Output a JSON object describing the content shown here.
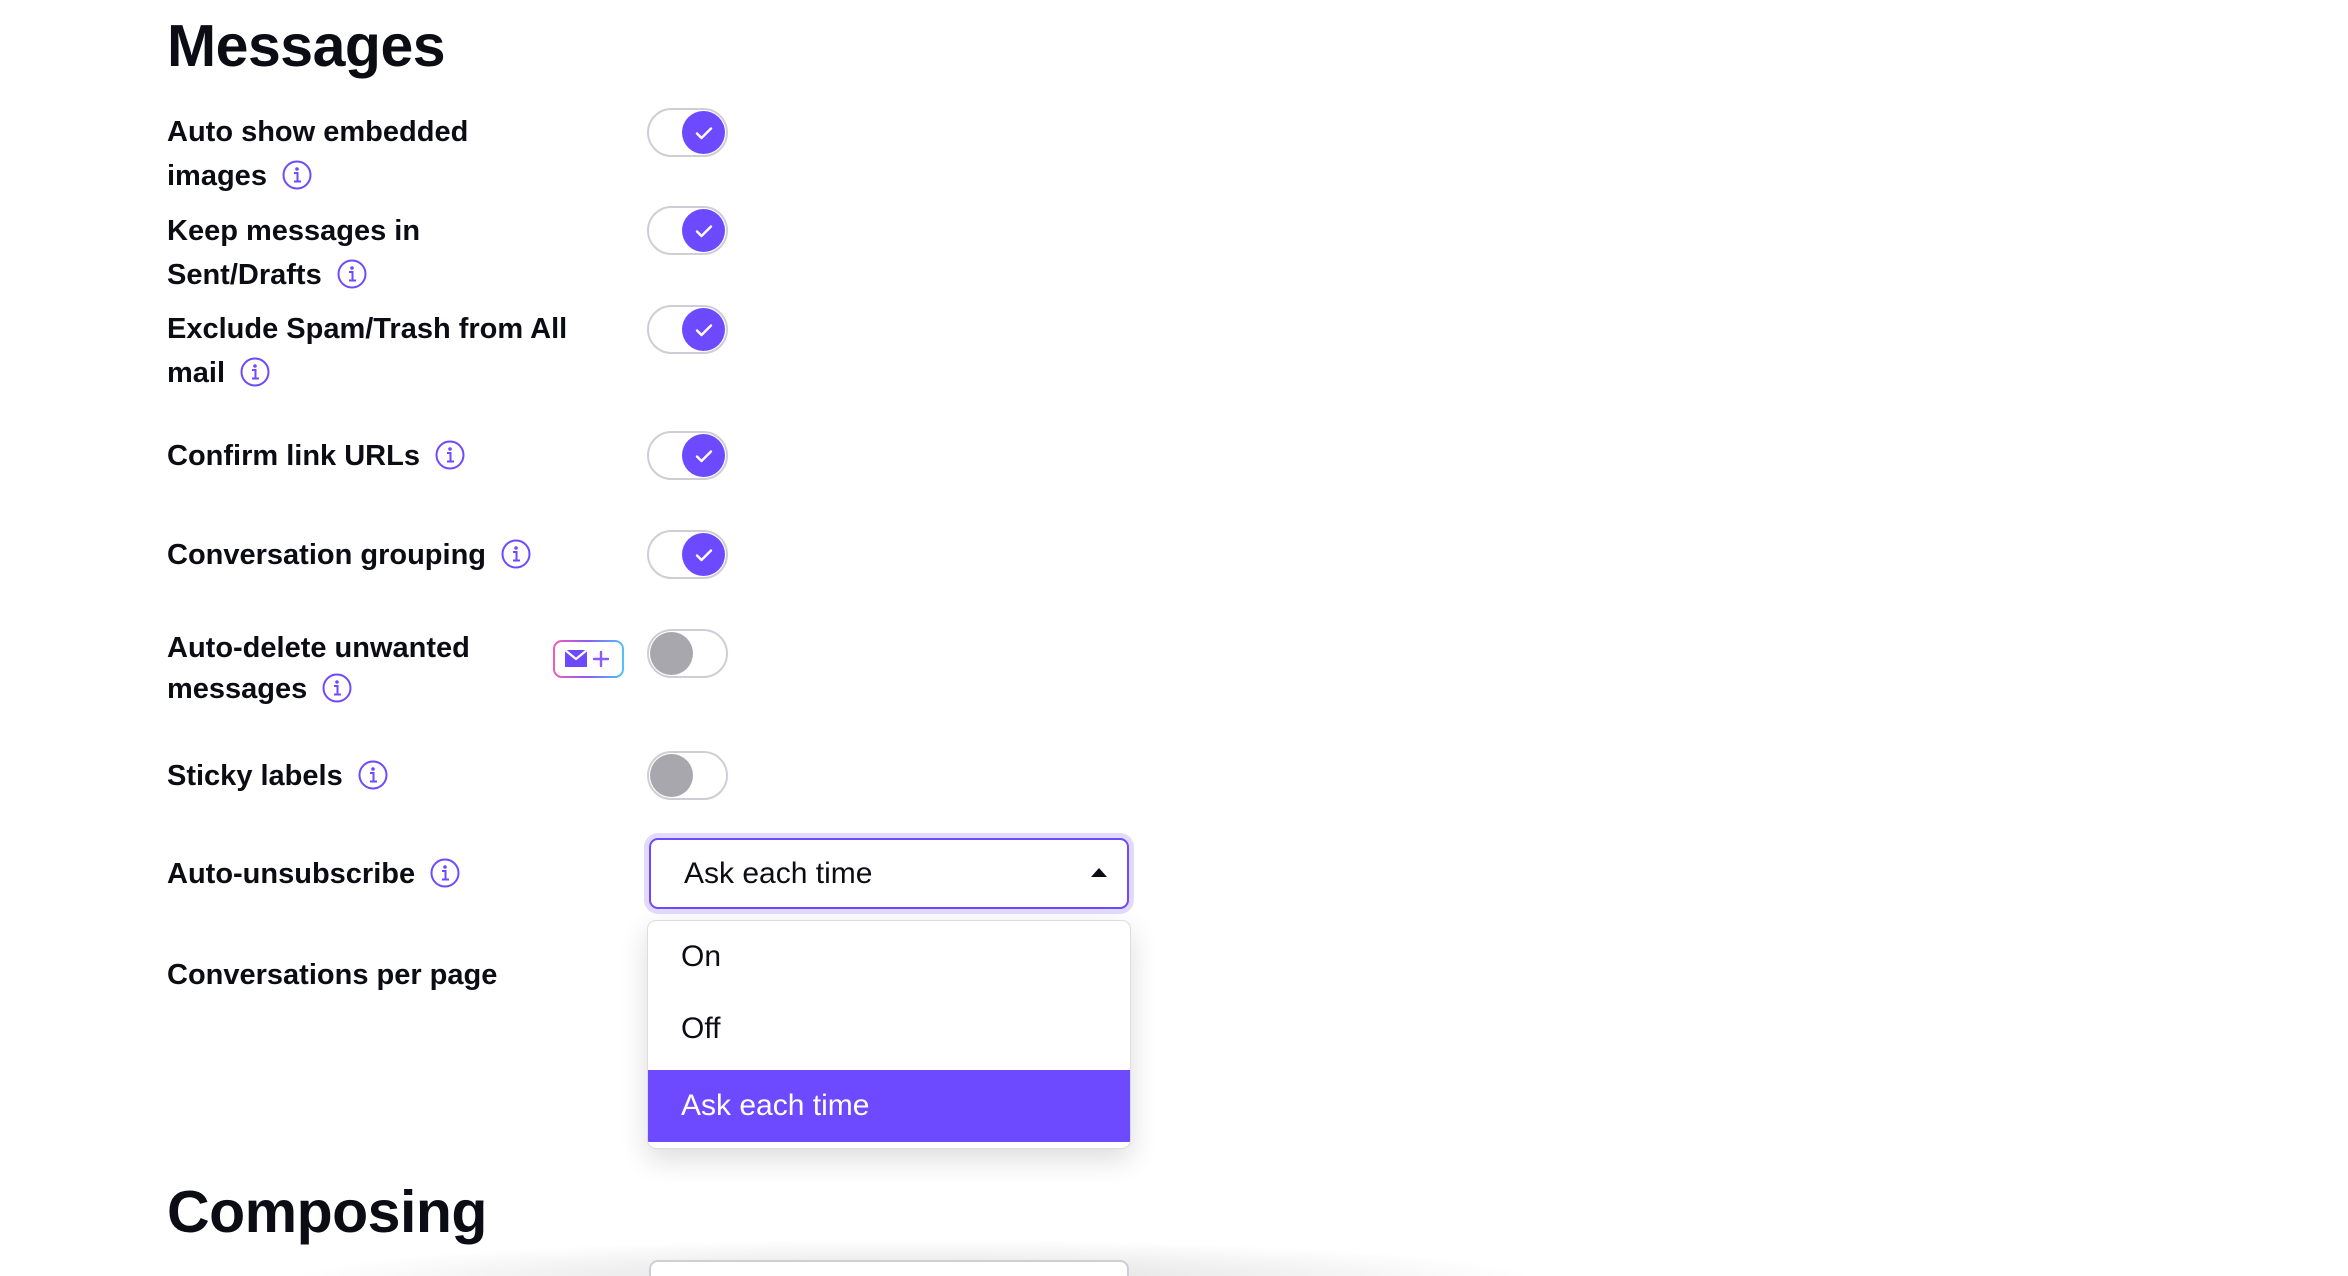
{
  "messages_section": {
    "title": "Messages",
    "settings": [
      {
        "label": "Auto show embedded images",
        "state": "on"
      },
      {
        "label": "Keep messages in Sent/Drafts",
        "state": "on"
      },
      {
        "label": "Exclude Spam/Trash from All mail",
        "state": "on"
      },
      {
        "label": "Confirm link URLs",
        "state": "on"
      },
      {
        "label": "Conversation grouping",
        "state": "on"
      },
      {
        "label": "Auto-delete unwanted messages",
        "state": "off",
        "upsell_icon": "mail-plus-icon"
      },
      {
        "label": "Sticky labels",
        "state": "off"
      },
      {
        "label": "Auto-unsubscribe",
        "control": "select"
      },
      {
        "label": "Conversations per page",
        "control": "select-hidden"
      }
    ]
  },
  "auto_unsubscribe_select": {
    "value": "Ask each time",
    "options": [
      "On",
      "Off",
      "Ask each time"
    ],
    "selected_index": 2
  },
  "composing_section": {
    "title": "Composing"
  },
  "colors": {
    "accent": "#6d4aff",
    "toggle_off": "#a8a7ad",
    "text": "#0c0c14"
  },
  "icons": {
    "info": "info-icon",
    "check": "check-icon",
    "caret": "caret-up-icon"
  }
}
